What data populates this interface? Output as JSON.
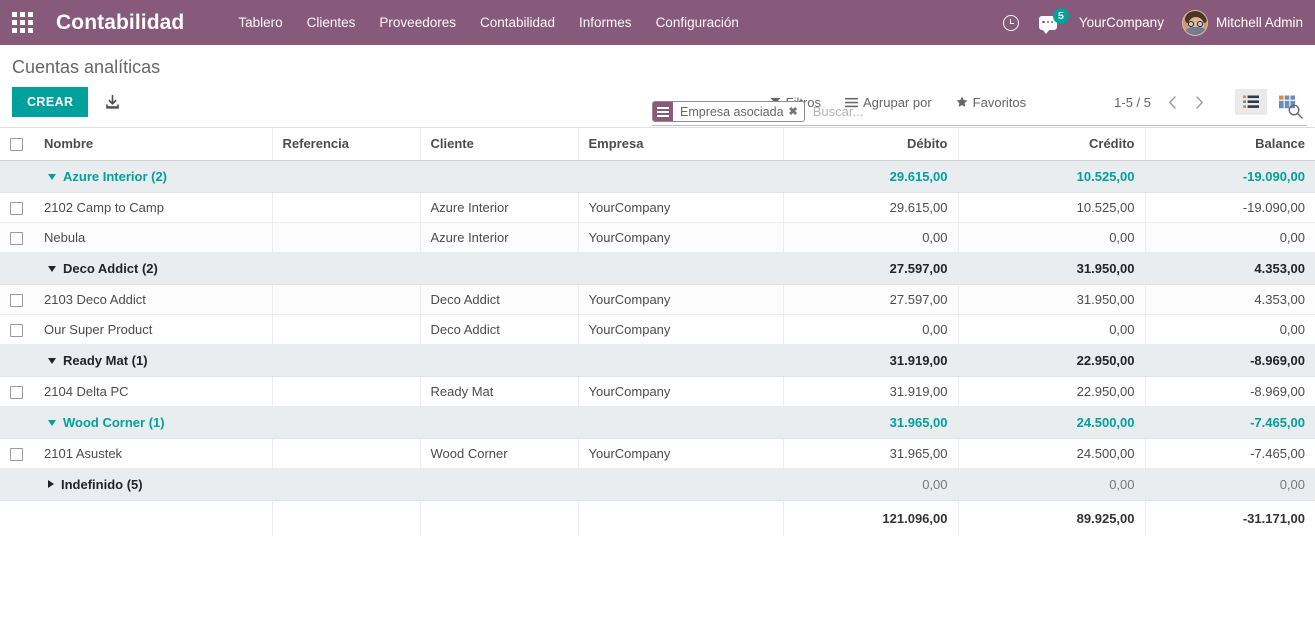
{
  "navbar": {
    "apps_icon": "apps-grid-icon",
    "brand": "Contabilidad",
    "menu": [
      {
        "label": "Tablero"
      },
      {
        "label": "Clientes"
      },
      {
        "label": "Proveedores"
      },
      {
        "label": "Contabilidad"
      },
      {
        "label": "Informes"
      },
      {
        "label": "Configuración"
      }
    ],
    "activity_icon": "clock-icon",
    "messages_icon": "chat-icon",
    "messages_count": "5",
    "company": "YourCompany",
    "user": "Mitchell Admin",
    "colors": {
      "navbar_bg": "#875A7B",
      "badge_bg": "#00A09D"
    }
  },
  "control_panel": {
    "title": "Cuentas analíticas",
    "create_label": "CREAR",
    "import_icon": "import-icon",
    "search": {
      "facet_label": "Empresa asociada",
      "facet_icon": "group-by-icon",
      "facet_remove_icon": "close-icon",
      "placeholder": "Buscar...",
      "value": "",
      "search_icon": "search-icon"
    },
    "filters_label": "Filtros",
    "groupby_label": "Agrupar por",
    "favorites_label": "Favoritos",
    "pager": "1-5 / 5",
    "prev_icon": "chevron-left-icon",
    "next_icon": "chevron-right-icon",
    "view_list_icon": "list-view-icon",
    "view_kanban_icon": "kanban-view-icon",
    "active_view": "list"
  },
  "table": {
    "columns": [
      {
        "label": "Nombre",
        "align": "left"
      },
      {
        "label": "Referencia",
        "align": "left"
      },
      {
        "label": "Cliente",
        "align": "left"
      },
      {
        "label": "Empresa",
        "align": "left"
      },
      {
        "label": "Débito",
        "align": "right"
      },
      {
        "label": "Crédito",
        "align": "right"
      },
      {
        "label": "Balance",
        "align": "right"
      }
    ],
    "groups": [
      {
        "name": "Azure Interior (2)",
        "expanded": true,
        "highlight": true,
        "debit": "29.615,00",
        "credit": "10.525,00",
        "balance": "-19.090,00",
        "rows": [
          {
            "name": "2102 Camp to Camp",
            "reference": "",
            "customer": "Azure Interior",
            "company": "YourCompany",
            "debit": "29.615,00",
            "credit": "10.525,00",
            "balance": "-19.090,00"
          },
          {
            "name": "Nebula",
            "reference": "",
            "customer": "Azure Interior",
            "company": "YourCompany",
            "debit": "0,00",
            "credit": "0,00",
            "balance": "0,00"
          }
        ]
      },
      {
        "name": "Deco Addict (2)",
        "expanded": true,
        "highlight": false,
        "debit": "27.597,00",
        "credit": "31.950,00",
        "balance": "4.353,00",
        "rows": [
          {
            "name": "2103 Deco Addict",
            "reference": "",
            "customer": "Deco Addict",
            "company": "YourCompany",
            "debit": "27.597,00",
            "credit": "31.950,00",
            "balance": "4.353,00"
          },
          {
            "name": "Our Super Product",
            "reference": "",
            "customer": "Deco Addict",
            "company": "YourCompany",
            "debit": "0,00",
            "credit": "0,00",
            "balance": "0,00"
          }
        ]
      },
      {
        "name": "Ready Mat (1)",
        "expanded": true,
        "highlight": false,
        "debit": "31.919,00",
        "credit": "22.950,00",
        "balance": "-8.969,00",
        "rows": [
          {
            "name": "2104 Delta PC",
            "reference": "",
            "customer": "Ready Mat",
            "company": "YourCompany",
            "debit": "31.919,00",
            "credit": "22.950,00",
            "balance": "-8.969,00"
          }
        ]
      },
      {
        "name": "Wood Corner (1)",
        "expanded": true,
        "highlight": true,
        "debit": "31.965,00",
        "credit": "24.500,00",
        "balance": "-7.465,00",
        "rows": [
          {
            "name": "2101 Asustek",
            "reference": "",
            "customer": "Wood Corner",
            "company": "YourCompany",
            "debit": "31.965,00",
            "credit": "24.500,00",
            "balance": "-7.465,00"
          }
        ]
      },
      {
        "name": "Indefinido (5)",
        "expanded": false,
        "highlight": false,
        "zero": true,
        "debit": "0,00",
        "credit": "0,00",
        "balance": "0,00",
        "rows": []
      }
    ],
    "totals": {
      "debit": "121.096,00",
      "credit": "89.925,00",
      "balance": "-31.171,00"
    }
  }
}
